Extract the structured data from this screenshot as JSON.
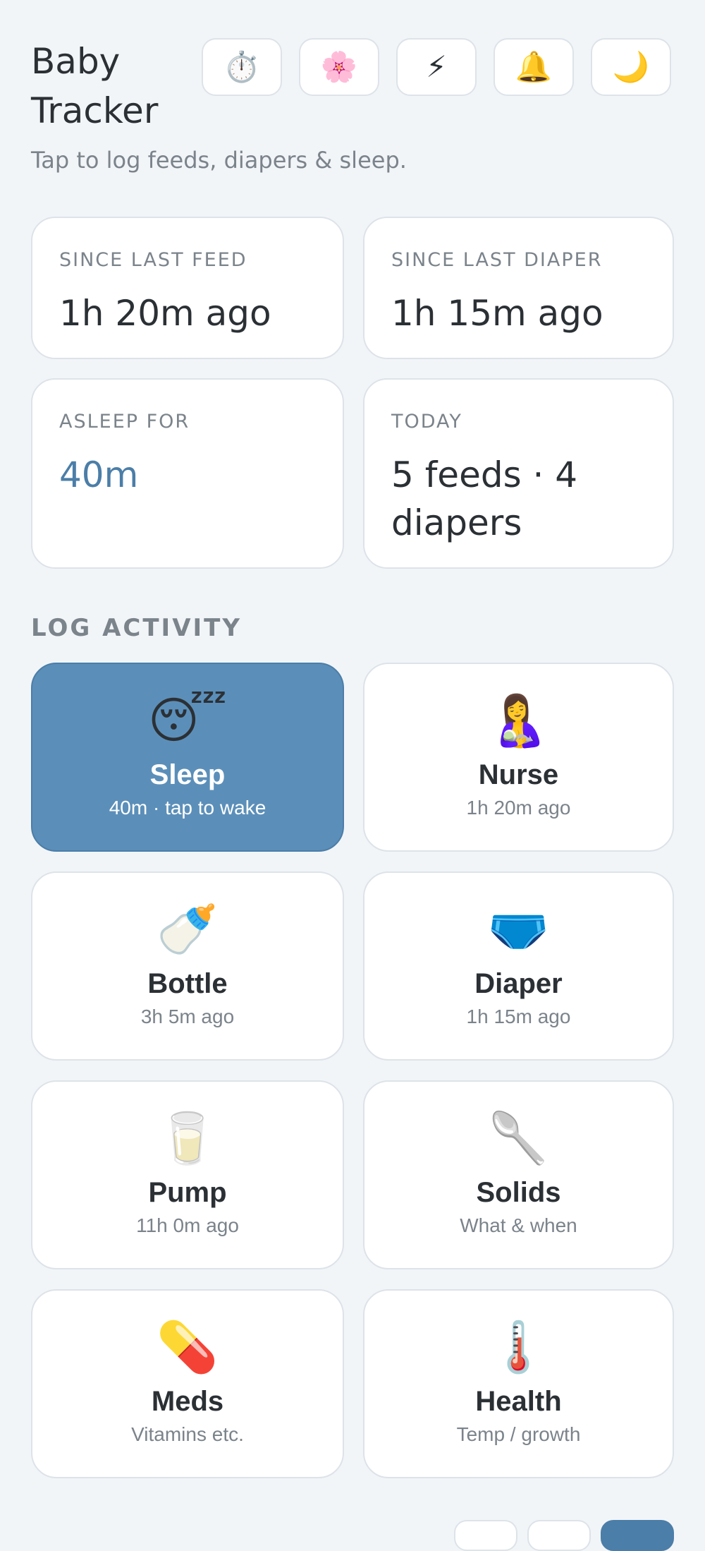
{
  "header": {
    "title": "Baby Tracker",
    "subtitle": "Tap to log feeds, diapers & sleep."
  },
  "toolbar": [
    {
      "name": "stopwatch-icon",
      "glyph": "⏱️"
    },
    {
      "name": "flower-icon",
      "glyph": "🌸"
    },
    {
      "name": "lightning-icon",
      "glyph": "⚡"
    },
    {
      "name": "bell-icon",
      "glyph": "🔔"
    },
    {
      "name": "moon-icon",
      "glyph": "🌙"
    }
  ],
  "stats": [
    {
      "label": "SINCE LAST FEED",
      "value": "1h 20m ago"
    },
    {
      "label": "SINCE LAST DIAPER",
      "value": "1h 15m ago"
    },
    {
      "label": "ASLEEP FOR",
      "value": "40m"
    },
    {
      "label": "TODAY",
      "value": "5 feeds · 4 diapers"
    }
  ],
  "section_label": "LOG ACTIVITY",
  "activities": [
    {
      "label": "Sleep",
      "sub": "40m · tap to wake",
      "icon": "😴",
      "icon_name": "sleeping-face-icon"
    },
    {
      "label": "Nurse",
      "sub": "1h 20m ago",
      "icon": "🤱",
      "icon_name": "breastfeeding-icon"
    },
    {
      "label": "Bottle",
      "sub": "3h 5m ago",
      "icon": "🍼",
      "icon_name": "baby-bottle-icon"
    },
    {
      "label": "Diaper",
      "sub": "1h 15m ago",
      "icon": "🩲",
      "icon_name": "diaper-icon"
    },
    {
      "label": "Pump",
      "sub": "11h 0m ago",
      "icon": "🥛",
      "icon_name": "pump-icon"
    },
    {
      "label": "Solids",
      "sub": "What & when",
      "icon": "🥄",
      "icon_name": "spoon-icon"
    },
    {
      "label": "Meds",
      "sub": "Vitamins etc.",
      "icon": "💊",
      "icon_name": "pill-icon"
    },
    {
      "label": "Health",
      "sub": "Temp / growth",
      "icon": "🌡️",
      "icon_name": "thermometer-icon"
    }
  ],
  "colors": {
    "accent": "#4b7ea8",
    "active_tile": "#5b8fb9",
    "background": "#f2f5f8"
  }
}
